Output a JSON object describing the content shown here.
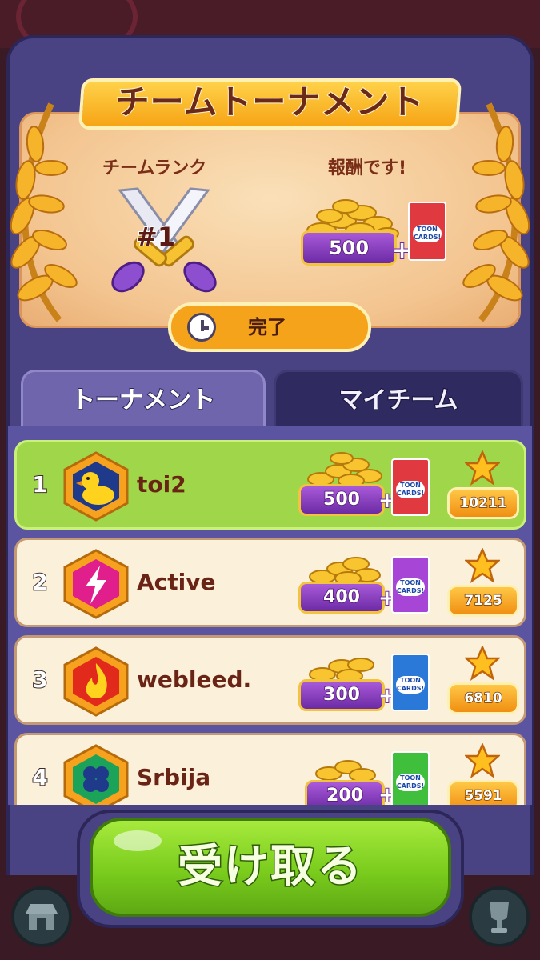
{
  "header": {
    "title": "チームトーナメント",
    "rank_label": "チームランク",
    "rank_value": "#1",
    "reward_label": "報酬です!",
    "reward_coins": "500",
    "status": "完了"
  },
  "tabs": [
    {
      "label": "トーナメント",
      "active": true
    },
    {
      "label": "マイチーム",
      "active": false
    }
  ],
  "leaderboard": [
    {
      "rank": "1",
      "name": "toi2",
      "coins": "500",
      "score": "10211",
      "badge": "duck-icon",
      "badge_color": "#1f3a8a",
      "pack_color": "#e0393f",
      "me": true
    },
    {
      "rank": "2",
      "name": "Active",
      "coins": "400",
      "score": "7125",
      "badge": "lightning-icon",
      "badge_color": "#e01e8c",
      "pack_color": "#a746d6",
      "me": false
    },
    {
      "rank": "3",
      "name": "webleed.",
      "coins": "300",
      "score": "6810",
      "badge": "flame-icon",
      "badge_color": "#e22a1c",
      "pack_color": "#2a78d8",
      "me": false
    },
    {
      "rank": "4",
      "name": "Srbija",
      "coins": "200",
      "score": "5591",
      "badge": "clover-icon",
      "badge_color": "#1ca35a",
      "pack_color": "#3fbf3c",
      "me": false
    }
  ],
  "pack_logo": "TOON CARDS!",
  "plus_sign": "+",
  "claim_button": "受け取る",
  "nav": {
    "left": "shop-icon",
    "right": "trophy-icon"
  }
}
